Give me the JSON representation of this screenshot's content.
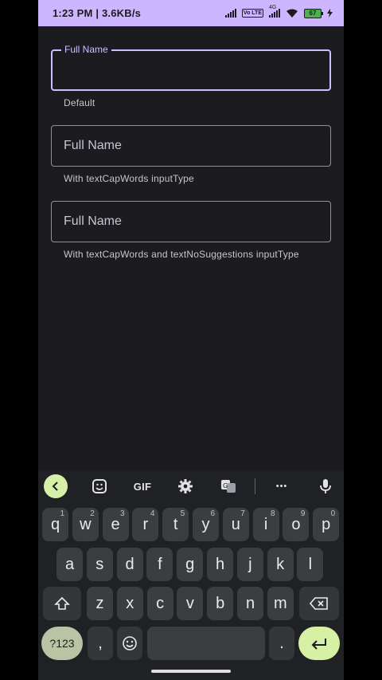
{
  "status_bar": {
    "time": "1:23 PM | 3.6KB/s",
    "net_badge": "Vo LTE",
    "net_type": "4G",
    "battery": "67"
  },
  "fields": [
    {
      "label": "Full Name",
      "supporting": "Default",
      "focused": true
    },
    {
      "label": "Full Name",
      "supporting": "With textCapWords inputType",
      "focused": false
    },
    {
      "label": "Full Name",
      "supporting": "With textCapWords and textNoSuggestions inputType",
      "focused": false
    }
  ],
  "keyboard": {
    "toolbar": [
      "chevron-left-icon",
      "sticker-icon",
      "GIF",
      "gear-icon",
      "translate-icon",
      "more-icon",
      "mic-icon"
    ],
    "gif_label": "GIF",
    "more_label": "•••",
    "row1": [
      {
        "k": "q",
        "h": "1"
      },
      {
        "k": "w",
        "h": "2"
      },
      {
        "k": "e",
        "h": "3"
      },
      {
        "k": "r",
        "h": "4"
      },
      {
        "k": "t",
        "h": "5"
      },
      {
        "k": "y",
        "h": "6"
      },
      {
        "k": "u",
        "h": "7"
      },
      {
        "k": "i",
        "h": "8"
      },
      {
        "k": "o",
        "h": "9"
      },
      {
        "k": "p",
        "h": "0"
      }
    ],
    "row2": [
      "a",
      "s",
      "d",
      "f",
      "g",
      "h",
      "j",
      "k",
      "l"
    ],
    "row3": [
      "z",
      "x",
      "c",
      "v",
      "b",
      "n",
      "m"
    ],
    "symbols_label": "?123",
    "comma_label": ",",
    "period_label": ".",
    "colors": {
      "accent": "#d0bcff",
      "enter": "#d6f0a5",
      "status_bar": "#cdb6ff"
    }
  }
}
